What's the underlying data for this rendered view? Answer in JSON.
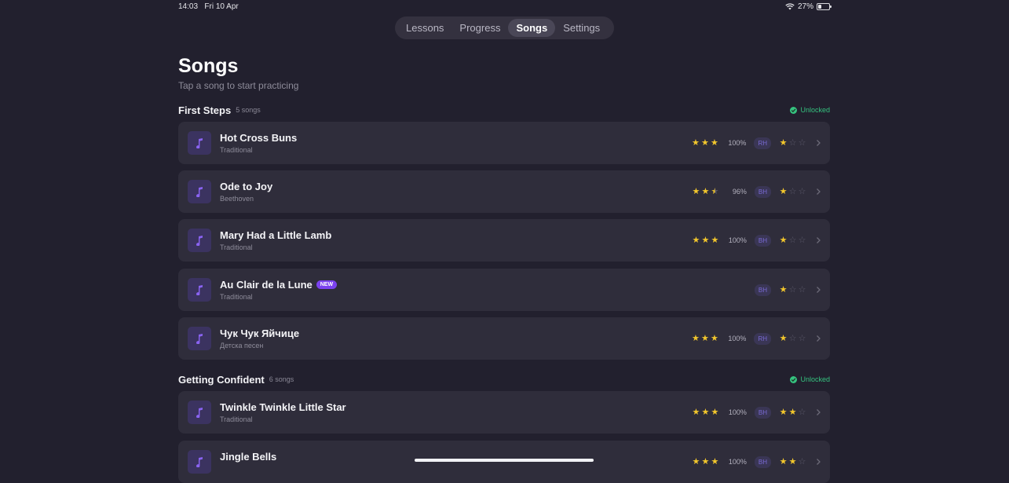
{
  "status_bar": {
    "time": "14:03",
    "date": "Fri 10 Apr",
    "battery": "27%"
  },
  "tabs": [
    {
      "label": "Lessons",
      "active": false
    },
    {
      "label": "Progress",
      "active": false
    },
    {
      "label": "Songs",
      "active": true
    },
    {
      "label": "Settings",
      "active": false
    }
  ],
  "page": {
    "title": "Songs",
    "subtitle": "Tap a song to start practicing"
  },
  "sections": [
    {
      "title": "First Steps",
      "count": "5 songs",
      "status": "Unlocked",
      "songs": [
        {
          "title": "Hot Cross Buns",
          "artist": "Traditional",
          "score_stars": 3,
          "percent": "100%",
          "hand": "RH",
          "difficulty": 1,
          "badge": ""
        },
        {
          "title": "Ode to Joy",
          "artist": "Beethoven",
          "score_stars": 2.5,
          "percent": "96%",
          "hand": "BH",
          "difficulty": 1,
          "badge": ""
        },
        {
          "title": "Mary Had a Little Lamb",
          "artist": "Traditional",
          "score_stars": 3,
          "percent": "100%",
          "hand": "BH",
          "difficulty": 1,
          "badge": ""
        },
        {
          "title": "Au Clair de la Lune",
          "artist": "Traditional",
          "score_stars": 0,
          "percent": "",
          "hand": "BH",
          "difficulty": 1,
          "badge": "NEW"
        },
        {
          "title": "Чук Чук Яйчице",
          "artist": "Детска песен",
          "score_stars": 3,
          "percent": "100%",
          "hand": "RH",
          "difficulty": 1,
          "badge": ""
        }
      ]
    },
    {
      "title": "Getting Confident",
      "count": "6 songs",
      "status": "Unlocked",
      "songs": [
        {
          "title": "Twinkle Twinkle Little Star",
          "artist": "Traditional",
          "score_stars": 3,
          "percent": "100%",
          "hand": "BH",
          "difficulty": 2,
          "badge": ""
        },
        {
          "title": "Jingle Bells",
          "artist": "",
          "score_stars": 3,
          "percent": "100%",
          "hand": "BH",
          "difficulty": 2,
          "badge": ""
        }
      ]
    }
  ],
  "colors": {
    "background": "#22202e",
    "card": "#2f2d3b",
    "star": "#f3c72c",
    "unlocked": "#35c27f",
    "accent": "#7b42f0"
  },
  "icons": {
    "song": "music-note-icon",
    "chevron": "chevron-right-icon",
    "status": "check-circle-icon"
  }
}
